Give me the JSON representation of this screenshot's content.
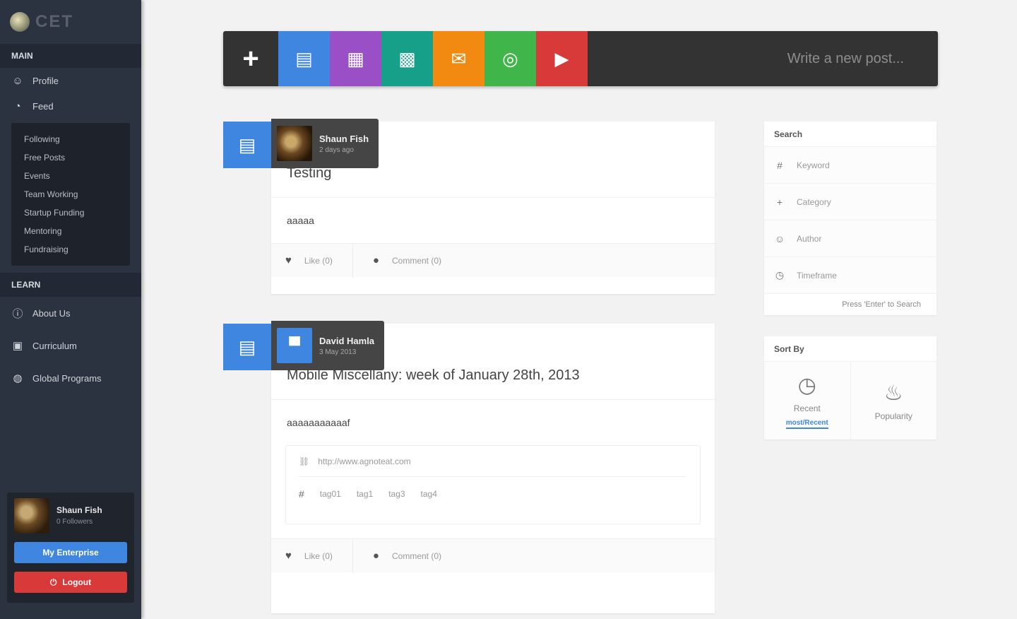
{
  "brand": {
    "word": "CET"
  },
  "sidebar": {
    "section_main": "MAIN",
    "main_items": [
      {
        "label": "Profile",
        "icon": "user-icon"
      },
      {
        "label": "Feed",
        "icon": "rss-icon"
      }
    ],
    "submenu": [
      "Following",
      "Free Posts",
      "Events",
      "Team Working",
      "Startup Funding",
      "Mentoring",
      "Fundraising"
    ],
    "section_learn": "LEARN",
    "learn_items": [
      {
        "label": "About Us",
        "icon": "info-icon"
      },
      {
        "label": "Curriculum",
        "icon": "book-icon"
      },
      {
        "label": "Global Programs",
        "icon": "globe-icon"
      }
    ]
  },
  "me": {
    "name": "Shaun Fish",
    "subtitle": "0 Followers",
    "primary_button": "My Enterprise",
    "logout_button": "Logout"
  },
  "composer": {
    "plus": "+",
    "types": [
      {
        "name": "text",
        "icon": "▤",
        "color": "#3f86e0"
      },
      {
        "name": "event",
        "icon": "▦",
        "color": "#9b4fc7"
      },
      {
        "name": "calendar",
        "icon": "▩",
        "color": "#16a08a"
      },
      {
        "name": "message",
        "icon": "✉",
        "color": "#f28a12"
      },
      {
        "name": "question",
        "icon": "◎",
        "color": "#3fb54a"
      },
      {
        "name": "video",
        "icon": "▶",
        "color": "#d83a3a"
      }
    ],
    "prompt": "Write a new post..."
  },
  "posts": [
    {
      "type_icon": "▤",
      "author": "Shaun Fish",
      "time": "2 days ago",
      "title": "Testing",
      "body": "aaaaa",
      "like": "Like (0)",
      "comment": "Comment (0)"
    },
    {
      "type_icon": "▤",
      "author": "David Hamla",
      "time": "3 May 2013",
      "title": "Mobile Miscellany: week of January 28th, 2013",
      "body": "aaaaaaaaaaaf",
      "url": "http://www.agnoteat.com",
      "tags": [
        "tag01",
        "tag1",
        "tag3",
        "tag4"
      ],
      "like": "Like (0)",
      "comment": "Comment (0)"
    }
  ],
  "search": {
    "title": "Search",
    "rows": [
      {
        "label": "Keyword",
        "icon": "tag-icon",
        "glyph": "#"
      },
      {
        "label": "Category",
        "icon": "plus-icon",
        "glyph": "+"
      },
      {
        "label": "Author",
        "icon": "user-icon",
        "glyph": "☺"
      },
      {
        "label": "Timeframe",
        "icon": "clock-icon",
        "glyph": "◷"
      }
    ],
    "link": "Press 'Enter' to Search"
  },
  "sortby": {
    "title": "Sort By",
    "options": [
      {
        "label": "Recent",
        "icon": "clock-icon",
        "glyph": "◷",
        "flag": "most/Recent"
      },
      {
        "label": "Popularity",
        "icon": "fire-icon",
        "glyph": "♨"
      }
    ]
  }
}
